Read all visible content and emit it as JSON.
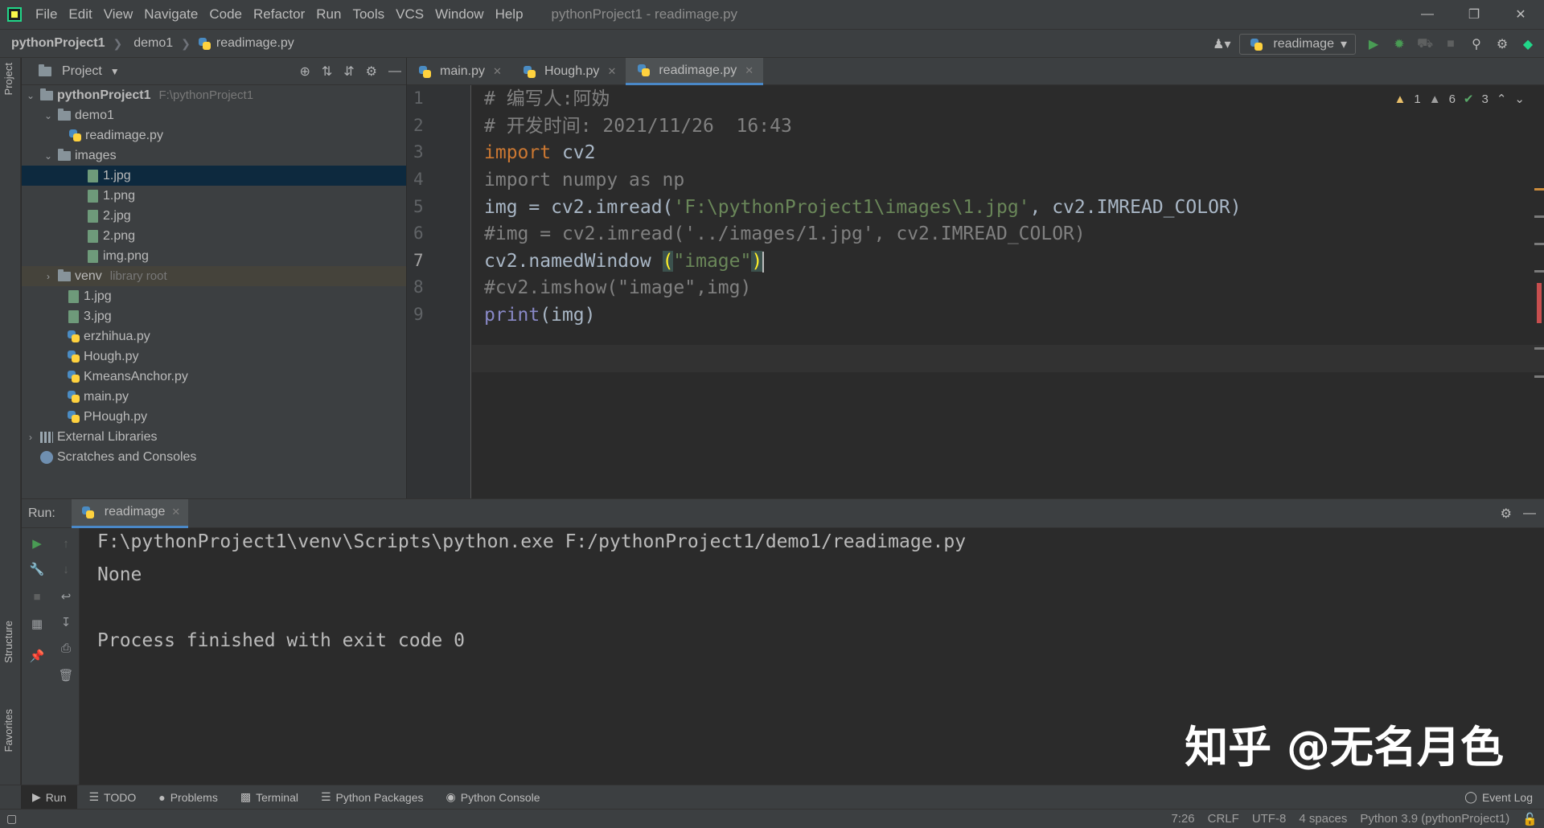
{
  "window": {
    "title": "pythonProject1 - readimage.py",
    "menu": [
      "File",
      "Edit",
      "View",
      "Navigate",
      "Code",
      "Refactor",
      "Run",
      "Tools",
      "VCS",
      "Window",
      "Help"
    ]
  },
  "breadcrumb": [
    "pythonProject1",
    "demo1",
    "readimage.py"
  ],
  "run_config": "readimage",
  "project_panel": {
    "title": "Project",
    "tree": [
      {
        "label": "pythonProject1",
        "path": "F:\\pythonProject1"
      },
      {
        "label": "demo1"
      },
      {
        "label": "readimage.py"
      },
      {
        "label": "images"
      },
      {
        "label": "1.jpg"
      },
      {
        "label": "1.png"
      },
      {
        "label": "2.jpg"
      },
      {
        "label": "2.png"
      },
      {
        "label": "img.png"
      },
      {
        "label": "venv",
        "path": "library root"
      },
      {
        "label": "1.jpg"
      },
      {
        "label": "3.jpg"
      },
      {
        "label": "erzhihua.py"
      },
      {
        "label": "Hough.py"
      },
      {
        "label": "KmeansAnchor.py"
      },
      {
        "label": "main.py"
      },
      {
        "label": "PHough.py"
      },
      {
        "label": "External Libraries"
      },
      {
        "label": "Scratches and Consoles"
      }
    ]
  },
  "editor": {
    "tabs": [
      "main.py",
      "Hough.py",
      "readimage.py"
    ],
    "active_tab": "readimage.py",
    "line_numbers": [
      "1",
      "2",
      "3",
      "4",
      "5",
      "6",
      "7",
      "8",
      "9"
    ],
    "lines": {
      "l1": "# 编写人:阿妫",
      "l2": "# 开发时间: 2021/11/26  16:43",
      "l3_kw": "import",
      "l3_rest": " cv2",
      "l4": "import numpy as np",
      "l5_a": "img = cv2.imread(",
      "l5_str": "'F:\\pythonProject1\\images\\1.jpg'",
      "l5_b": ", cv2.IMREAD_COLOR)",
      "l6": "#img = cv2.imread('../images/1.jpg', cv2.IMREAD_COLOR)",
      "l7_a": "cv2.namedWindow ",
      "l7_open": "(",
      "l7_str": "\"image\"",
      "l7_close": ")",
      "l8": "#cv2.imshow(\"image\",img)",
      "l9_fn": "print",
      "l9_rest": "(img)"
    },
    "inspections": {
      "errors": "1",
      "warnings": "6",
      "typos": "3"
    }
  },
  "run": {
    "label": "Run:",
    "tab": "readimage",
    "console": [
      "F:\\pythonProject1\\venv\\Scripts\\python.exe F:/pythonProject1/demo1/readimage.py",
      "None",
      "",
      "Process finished with exit code 0"
    ]
  },
  "watermark": "知乎 @无名月色",
  "tool_windows": [
    "Run",
    "TODO",
    "Problems",
    "Terminal",
    "Python Packages",
    "Python Console"
  ],
  "event_log": "Event Log",
  "side_tabs": {
    "project": "Project",
    "structure": "Structure",
    "favorites": "Favorites"
  },
  "status": {
    "position": "7:26",
    "line_sep": "CRLF",
    "encoding": "UTF-8",
    "indent": "4 spaces",
    "interpreter": "Python 3.9 (pythonProject1)"
  },
  "colors": {
    "accent": "#4a88c7",
    "keyword": "#cc7832",
    "string": "#6a8759",
    "comment": "#808080"
  }
}
